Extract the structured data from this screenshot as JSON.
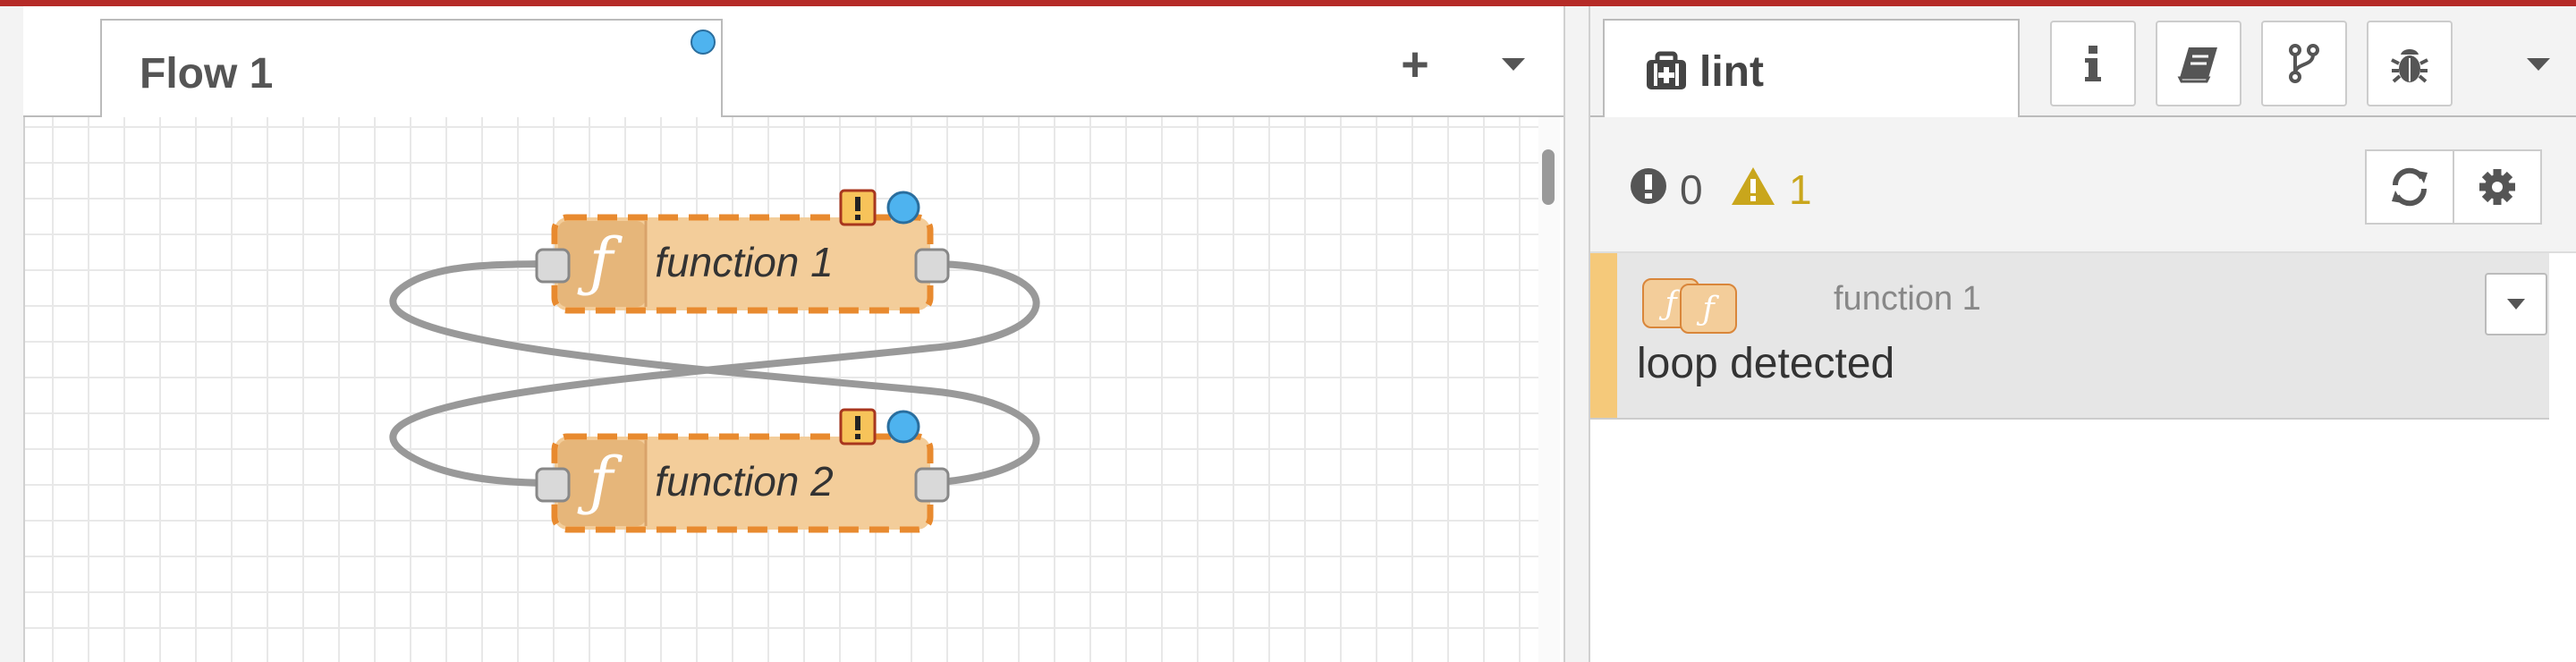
{
  "workspace": {
    "tab_label": "Flow 1",
    "add_label": "+",
    "nodes": [
      {
        "label": "function 1",
        "icon": "ƒ"
      },
      {
        "label": "function 2",
        "icon": "ƒ"
      }
    ],
    "colors": {
      "node_fill": "#f3cd9a",
      "node_border": "#e88a2f",
      "wire": "#999999",
      "status_dot": "#4eb3ef",
      "warning": "#f5c97a"
    }
  },
  "sidebar": {
    "active_tab": {
      "label": "lint",
      "icon": "medkit-icon"
    },
    "tab_buttons": [
      "info-icon",
      "book-icon",
      "branch-icon",
      "bug-icon"
    ],
    "counts": {
      "errors": "0",
      "warnings": "1"
    },
    "issue": {
      "node_label": "function 1",
      "message": "loop detected"
    }
  }
}
